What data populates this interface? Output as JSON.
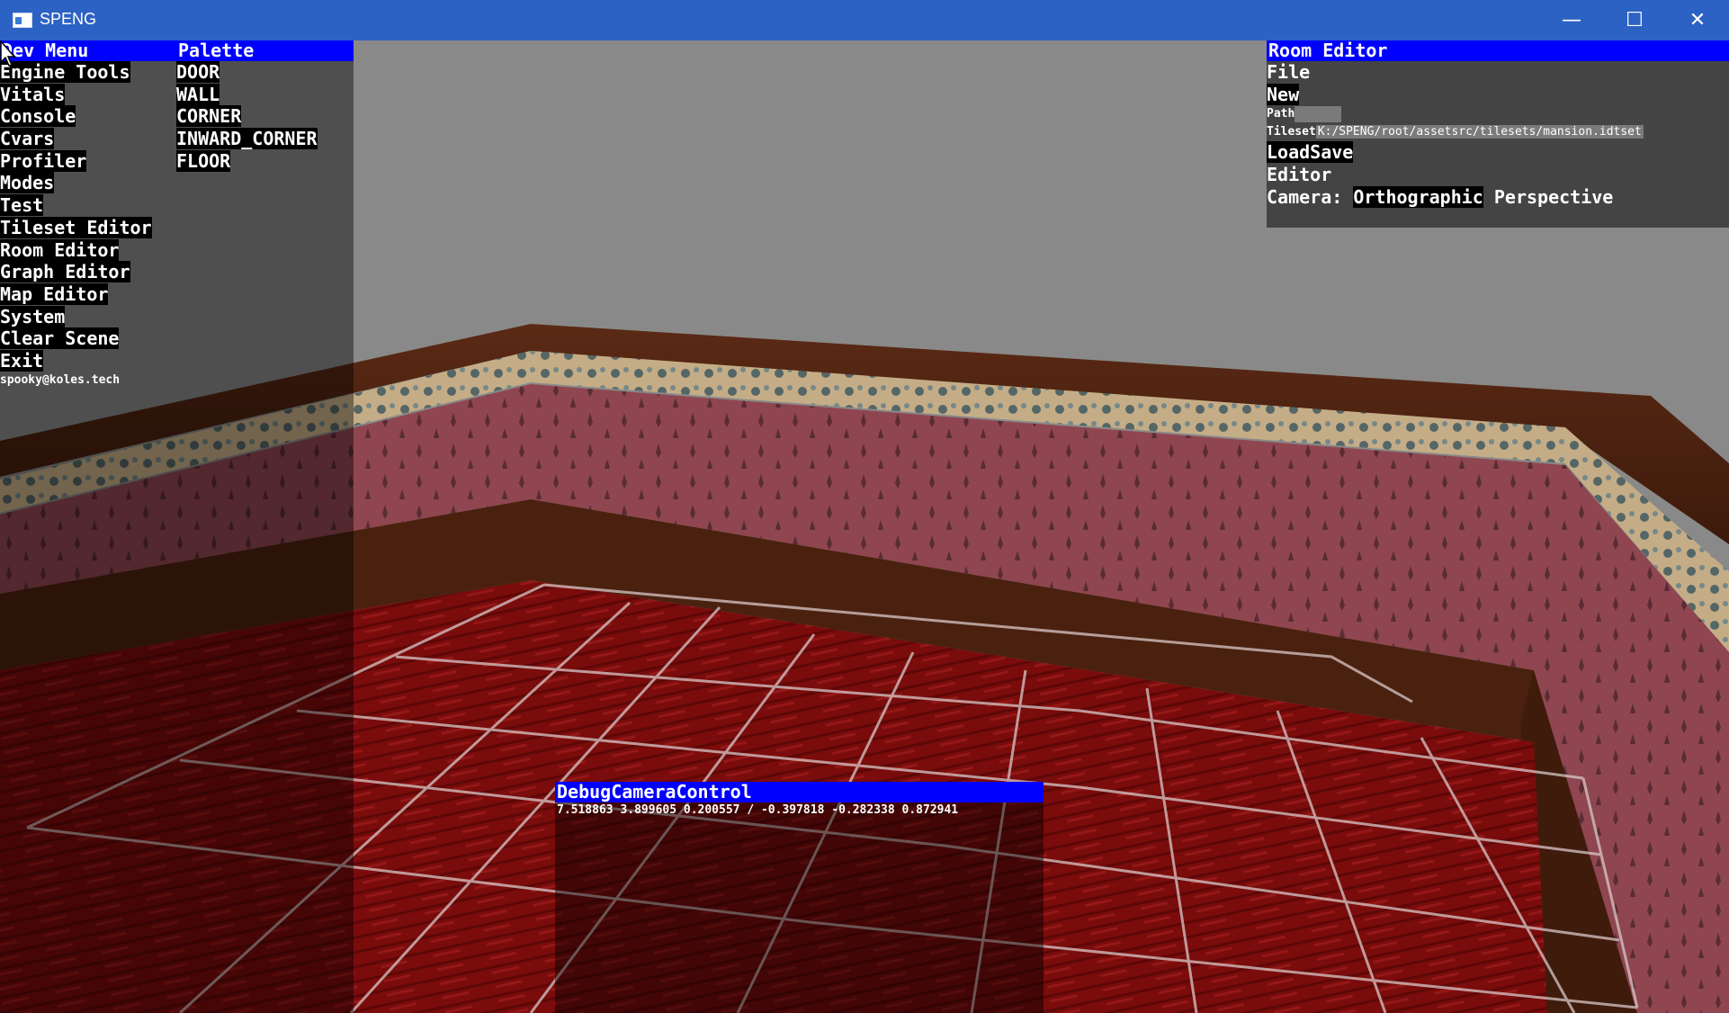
{
  "window": {
    "title": "SPENG",
    "minimize": "—",
    "maximize": "☐",
    "close": "✕"
  },
  "dev_menu": {
    "header": "Dev Menu",
    "items": [
      "Engine Tools",
      "Vitals",
      "Console",
      "Cvars",
      "Profiler",
      "Modes",
      "Test",
      "Tileset Editor",
      "Room Editor",
      "Graph Editor",
      "Map Editor",
      "System",
      "Clear Scene",
      "Exit"
    ],
    "footer": "spooky@koles.tech"
  },
  "palette": {
    "header": "Palette",
    "items": [
      "DOOR",
      "WALL",
      "CORNER",
      "INWARD_CORNER",
      "FLOOR"
    ]
  },
  "room_editor": {
    "header": "Room Editor",
    "file_label": "File",
    "new_label": "New",
    "path_label": "Path",
    "path_value": "",
    "tileset_label": "Tileset",
    "tileset_value": "K:/SPENG/root/assetsrc/tilesets/mansion.idtset",
    "load_label": "Load",
    "save_label": "Save",
    "editor_label": "Editor",
    "camera_label": "Camera:",
    "camera_options": [
      "Orthographic",
      "Perspective"
    ]
  },
  "debug_camera": {
    "header": "DebugCameraControl",
    "values": "7.518863 3.899605 0.200557 / -0.397818 -0.282338 0.872941"
  }
}
